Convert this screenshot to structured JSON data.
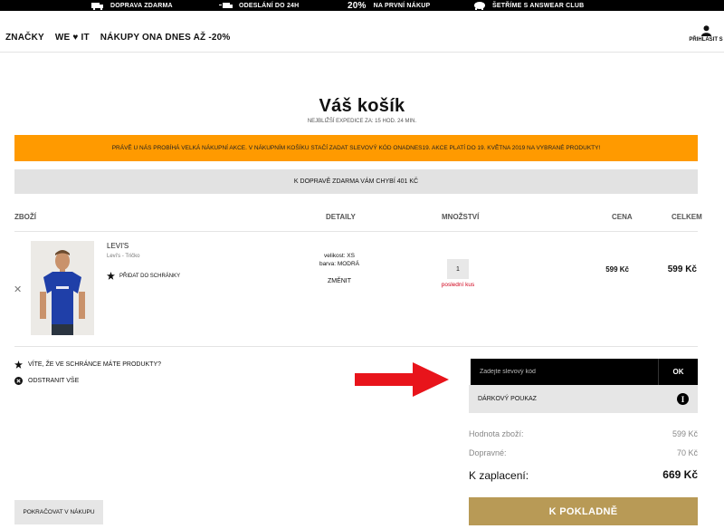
{
  "topbar": {
    "items": [
      {
        "icon": "truck-icon",
        "label": "Doprava zdarma"
      },
      {
        "icon": "fast-truck-icon",
        "label": "Odeslání do 24h"
      },
      {
        "big": "20%",
        "label": "na první nákup"
      },
      {
        "icon": "piggy-bank-icon",
        "label": "Šetříme s Answear Club"
      }
    ]
  },
  "nav": {
    "items": [
      "Značky",
      "We ♥ it",
      "Nákupy ona dnes až -20%"
    ],
    "login_label": "Přihlásit s",
    "login_icon": "user-icon"
  },
  "cart": {
    "title": "Váš košík",
    "expedice_label": "Nejbližší expedice za:",
    "expedice_value": "15 hod. 24 min.",
    "promo_banner": "Právě u nás probíhá velká nákupní akce. V nákupním košíku stačí zadat slevový kód ONADNES19. Akce platí do 19. května 2019 na vybrané produkty!",
    "shipping_banner": "K dopravě zdarma vám chybí 401 Kč",
    "columns": {
      "item": "Zboží",
      "details": "Detaily",
      "quantity": "Množství",
      "price": "Cena",
      "total": "Celkem"
    },
    "item": {
      "brand": "LEVI'S",
      "name": "Levi's - Tričko",
      "wishlist_label": "Přidat do schránky",
      "size_line": "velikost: XS",
      "color_line": "barva: MODRÁ",
      "change_label": "ZMĚNIT",
      "quantity": "1",
      "stock_note": "poslední kus",
      "price": "599 Kč",
      "total": "599 Kč"
    },
    "links": {
      "wishlist_info": "Víte, že ve schránce máte produkty?",
      "remove_all": "Odstranit vše"
    },
    "coupon": {
      "placeholder": "Zadejte slevový kód",
      "ok_label": "OK",
      "gift_label": "Dárkový poukaz"
    },
    "summary": {
      "goods_label": "Hodnota zboží:",
      "goods_value": "599 Kč",
      "shipping_label": "Dopravné:",
      "shipping_value": "70 Kč",
      "pay_label": "K zaplacení:",
      "pay_value": "669 Kč"
    },
    "continue_label": "Pokračovat v nákupu",
    "checkout_label": "K pokladně"
  },
  "colors": {
    "promo_orange": "#ff9a00",
    "checkout_gold": "#b89a56",
    "arrow_red": "#e8141b",
    "stock_red": "#d0021b"
  }
}
